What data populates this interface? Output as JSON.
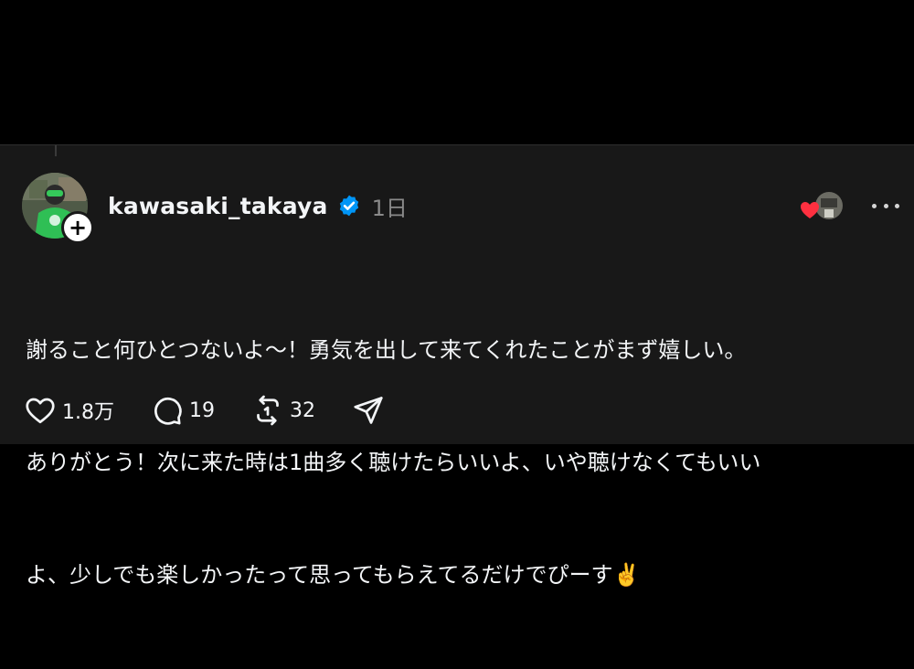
{
  "post": {
    "username": "kawasaki_takaya",
    "timestamp": "1日",
    "body_lines": [
      "謝ること何ひとつないよ〜！勇気を出して来てくれたことがまず嬉しい。",
      "ありがとう！次に来た時は1曲多く聴けたらいいよ、いや聴けなくてもいい",
      "よ、少しでも楽しかったって思ってもらえてるだけでぴーす✌️"
    ],
    "actions": {
      "like_count": "1.8万",
      "reply_count": "19",
      "repost_count": "32"
    },
    "icons": {
      "verified": "verified-badge-icon",
      "follow": "plus-icon",
      "more": "more-options-icon",
      "like": "heart-icon",
      "reply": "speech-bubble-icon",
      "repost": "repost-icon",
      "share": "send-icon"
    },
    "colors": {
      "background": "#000000",
      "card": "#181818",
      "verified_blue": "#0095f6",
      "like_red": "#ff3040",
      "secondary_text": "#8a8a8a"
    }
  }
}
